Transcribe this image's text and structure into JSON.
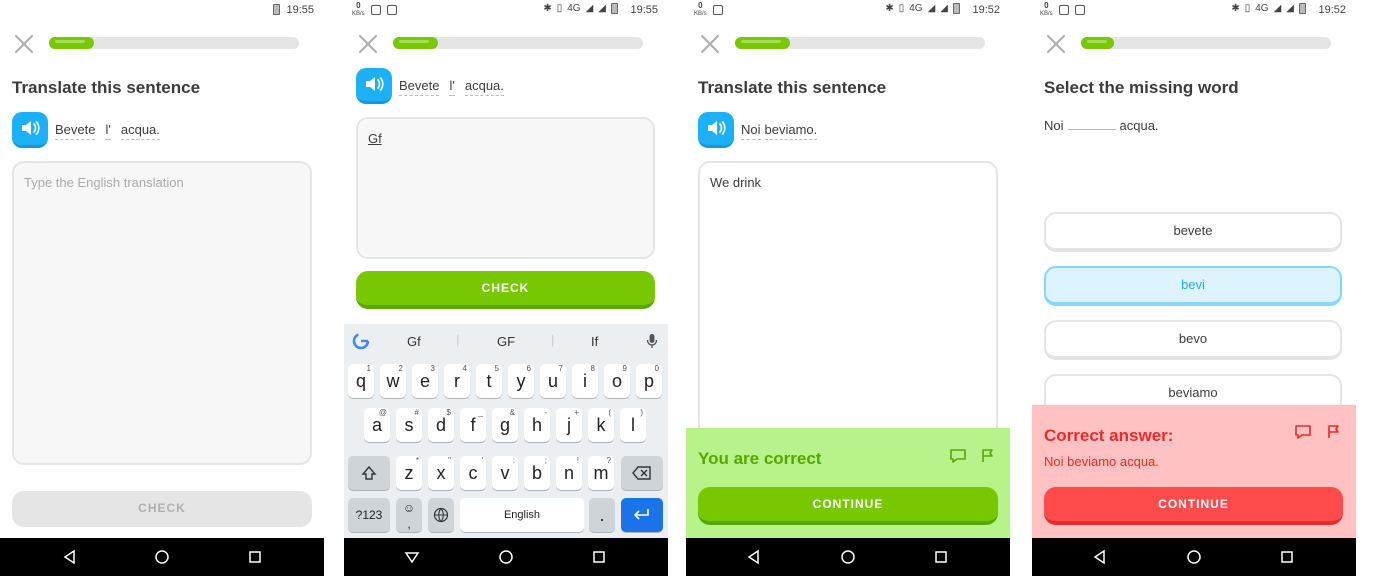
{
  "screens": [
    {
      "status": {
        "time": "19:55"
      },
      "title": "Translate this sentence",
      "sentence": [
        "Bevete",
        "l'",
        "acqua."
      ],
      "input_placeholder": "Type the English translation",
      "check_label": "CHECK"
    },
    {
      "status": {
        "time": "19:55",
        "net": "0",
        "unit": "KB/s",
        "signal": "4G"
      },
      "sentence": [
        "Bevete",
        "l'",
        "acqua."
      ],
      "input_value": "Gf",
      "check_label": "CHECK",
      "keyboard": {
        "suggestions": [
          "Gf",
          "GF",
          "If"
        ],
        "row1": [
          {
            "k": "q",
            "s": "1"
          },
          {
            "k": "w",
            "s": "2"
          },
          {
            "k": "e",
            "s": "3"
          },
          {
            "k": "r",
            "s": "4"
          },
          {
            "k": "t",
            "s": "5"
          },
          {
            "k": "y",
            "s": "6"
          },
          {
            "k": "u",
            "s": "7"
          },
          {
            "k": "i",
            "s": "8"
          },
          {
            "k": "o",
            "s": "9"
          },
          {
            "k": "p",
            "s": "0"
          }
        ],
        "row2": [
          {
            "k": "a",
            "s": "@"
          },
          {
            "k": "s",
            "s": "#"
          },
          {
            "k": "d",
            "s": "$"
          },
          {
            "k": "f",
            "s": "_"
          },
          {
            "k": "g",
            "s": "&"
          },
          {
            "k": "h",
            "s": "-"
          },
          {
            "k": "j",
            "s": "+"
          },
          {
            "k": "k",
            "s": "("
          },
          {
            "k": "l",
            "s": ")"
          }
        ],
        "row3": [
          {
            "k": "z",
            "s": "*"
          },
          {
            "k": "x",
            "s": "\""
          },
          {
            "k": "c",
            "s": "'"
          },
          {
            "k": "v",
            "s": ":"
          },
          {
            "k": "b",
            "s": ";"
          },
          {
            "k": "n",
            "s": "!"
          },
          {
            "k": "m",
            "s": "?"
          }
        ],
        "sym_label": "?123",
        "space_label": "English",
        "period_label": "."
      }
    },
    {
      "status": {
        "time": "19:52",
        "net": "0",
        "unit": "KB/s",
        "signal": "4G"
      },
      "title": "Translate this sentence",
      "sentence": [
        "Noi",
        "beviamo."
      ],
      "input_value": "We drink",
      "feedback_title": "You are correct",
      "continue_label": "CONTINUE"
    },
    {
      "status": {
        "time": "19:52",
        "net": "0",
        "unit": "KB/s",
        "signal": "4G"
      },
      "title": "Select the missing word",
      "sentence_before": "Noi",
      "sentence_after": "acqua.",
      "choices": [
        "bevete",
        "bevi",
        "bevo",
        "beviamo"
      ],
      "feedback_title": "Correct answer:",
      "feedback_answer": "Noi beviamo acqua.",
      "continue_label": "CONTINUE"
    }
  ],
  "colors": {
    "green": "#78c800",
    "blue": "#1cb0f6",
    "red": "#ff4b4b",
    "correct_bg": "#b8f28b",
    "wrong_bg": "#ffc1c1"
  },
  "progress": [
    0.18,
    0.18,
    0.22,
    0.13
  ]
}
